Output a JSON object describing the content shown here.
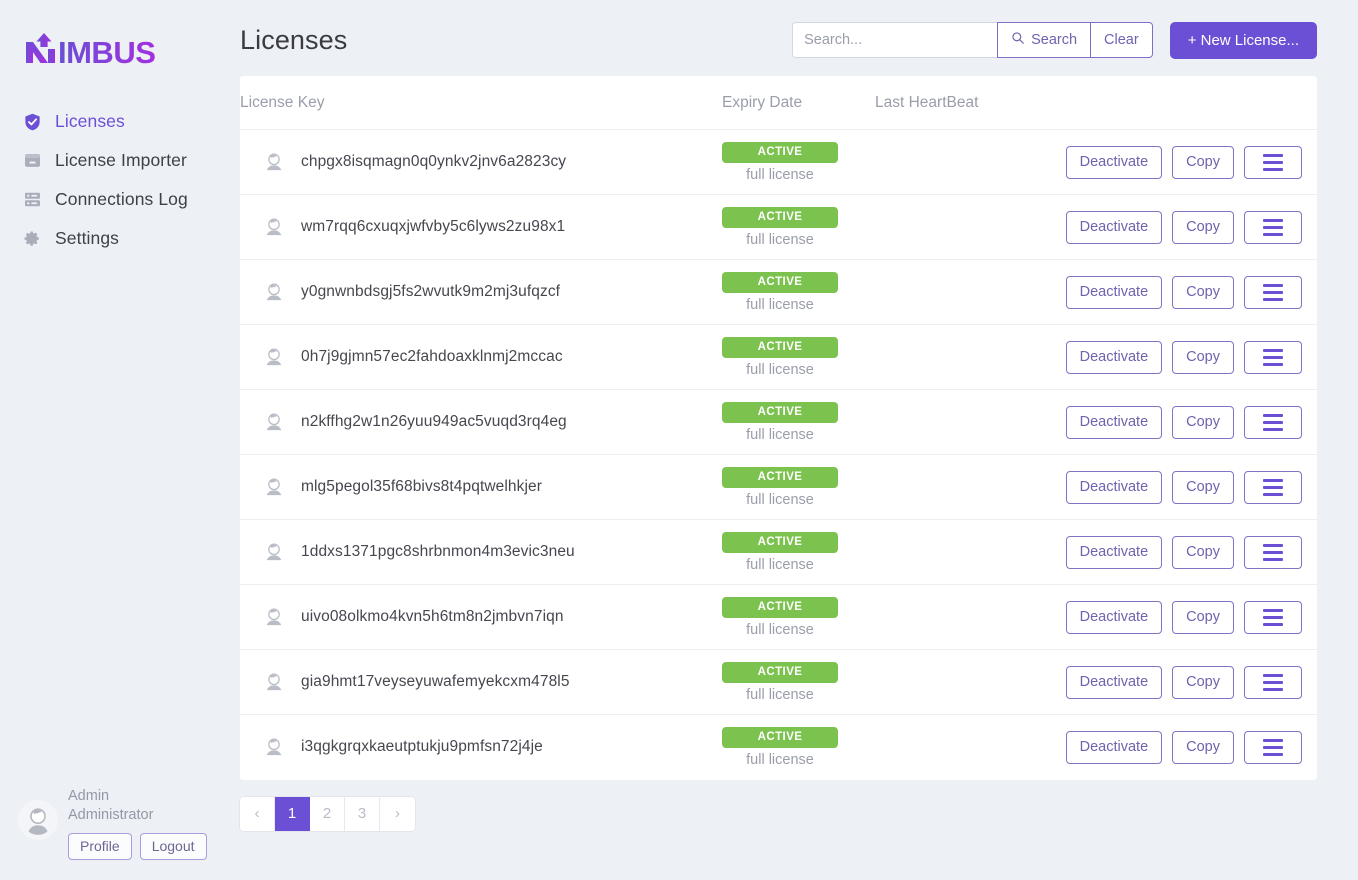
{
  "brand": {
    "name": "NIMBUS"
  },
  "sidebar": {
    "items": [
      {
        "label": "Licenses",
        "icon": "shield-check-icon",
        "active": true
      },
      {
        "label": "License Importer",
        "icon": "archive-box-icon",
        "active": false
      },
      {
        "label": "Connections Log",
        "icon": "server-rack-icon",
        "active": false
      },
      {
        "label": "Settings",
        "icon": "gear-icon",
        "active": false
      }
    ],
    "user": {
      "first_line": "Admin",
      "second_line": "Administrator",
      "profile_label": "Profile",
      "logout_label": "Logout",
      "avatar_icon": "user-avatar-icon"
    }
  },
  "header": {
    "title": "Licenses",
    "search_placeholder": "Search...",
    "search_value": "",
    "search_button_label": "Search",
    "search_icon": "magnifier-icon",
    "clear_button_label": "Clear",
    "new_license_button_label": "+ New License..."
  },
  "table": {
    "columns": [
      "License Key",
      "Expiry Date",
      "Last HeartBeat",
      ""
    ],
    "row_actions": {
      "deactivate_label": "Deactivate",
      "copy_label": "Copy",
      "menu_icon": "hamburger-menu-icon"
    },
    "rows": [
      {
        "avatar_icon": "user-avatar-icon",
        "key": "chpgx8isqmagn0q0ynkv2jnv6a2823cy",
        "status": "ACTIVE",
        "status_sub": "full license",
        "last_heartbeat": ""
      },
      {
        "avatar_icon": "user-avatar-icon",
        "key": "wm7rqq6cxuqxjwfvby5c6lyws2zu98x1",
        "status": "ACTIVE",
        "status_sub": "full license",
        "last_heartbeat": ""
      },
      {
        "avatar_icon": "user-avatar-icon",
        "key": "y0gnwnbdsgj5fs2wvutk9m2mj3ufqzcf",
        "status": "ACTIVE",
        "status_sub": "full license",
        "last_heartbeat": ""
      },
      {
        "avatar_icon": "user-avatar-icon",
        "key": "0h7j9gjmn57ec2fahdoaxklnmj2mccac",
        "status": "ACTIVE",
        "status_sub": "full license",
        "last_heartbeat": ""
      },
      {
        "avatar_icon": "user-avatar-icon",
        "key": "n2kffhg2w1n26yuu949ac5vuqd3rq4eg",
        "status": "ACTIVE",
        "status_sub": "full license",
        "last_heartbeat": ""
      },
      {
        "avatar_icon": "user-avatar-icon",
        "key": "mlg5pegol35f68bivs8t4pqtwelhkjer",
        "status": "ACTIVE",
        "status_sub": "full license",
        "last_heartbeat": ""
      },
      {
        "avatar_icon": "user-avatar-icon",
        "key": "1ddxs1371pgc8shrbnmon4m3evic3neu",
        "status": "ACTIVE",
        "status_sub": "full license",
        "last_heartbeat": ""
      },
      {
        "avatar_icon": "user-avatar-icon",
        "key": "uivo08olkmo4kvn5h6tm8n2jmbvn7iqn",
        "status": "ACTIVE",
        "status_sub": "full license",
        "last_heartbeat": ""
      },
      {
        "avatar_icon": "user-avatar-icon",
        "key": "gia9hmt17veyseyuwafemyekcxm478l5",
        "status": "ACTIVE",
        "status_sub": "full license",
        "last_heartbeat": ""
      },
      {
        "avatar_icon": "user-avatar-icon",
        "key": "i3qgkgrqxkaeutptukju9pmfsn72j4je",
        "status": "ACTIVE",
        "status_sub": "full license",
        "last_heartbeat": ""
      }
    ]
  },
  "pagination": {
    "prev_label": "‹",
    "next_label": "›",
    "pages": [
      "1",
      "2",
      "3"
    ],
    "active_page": "1"
  },
  "colors": {
    "accent_purple": "#6b4fd4",
    "status_green": "#7cc24e",
    "page_background": "#edf1f5",
    "card_background": "#ffffff",
    "muted_text": "#9a9eaa"
  }
}
